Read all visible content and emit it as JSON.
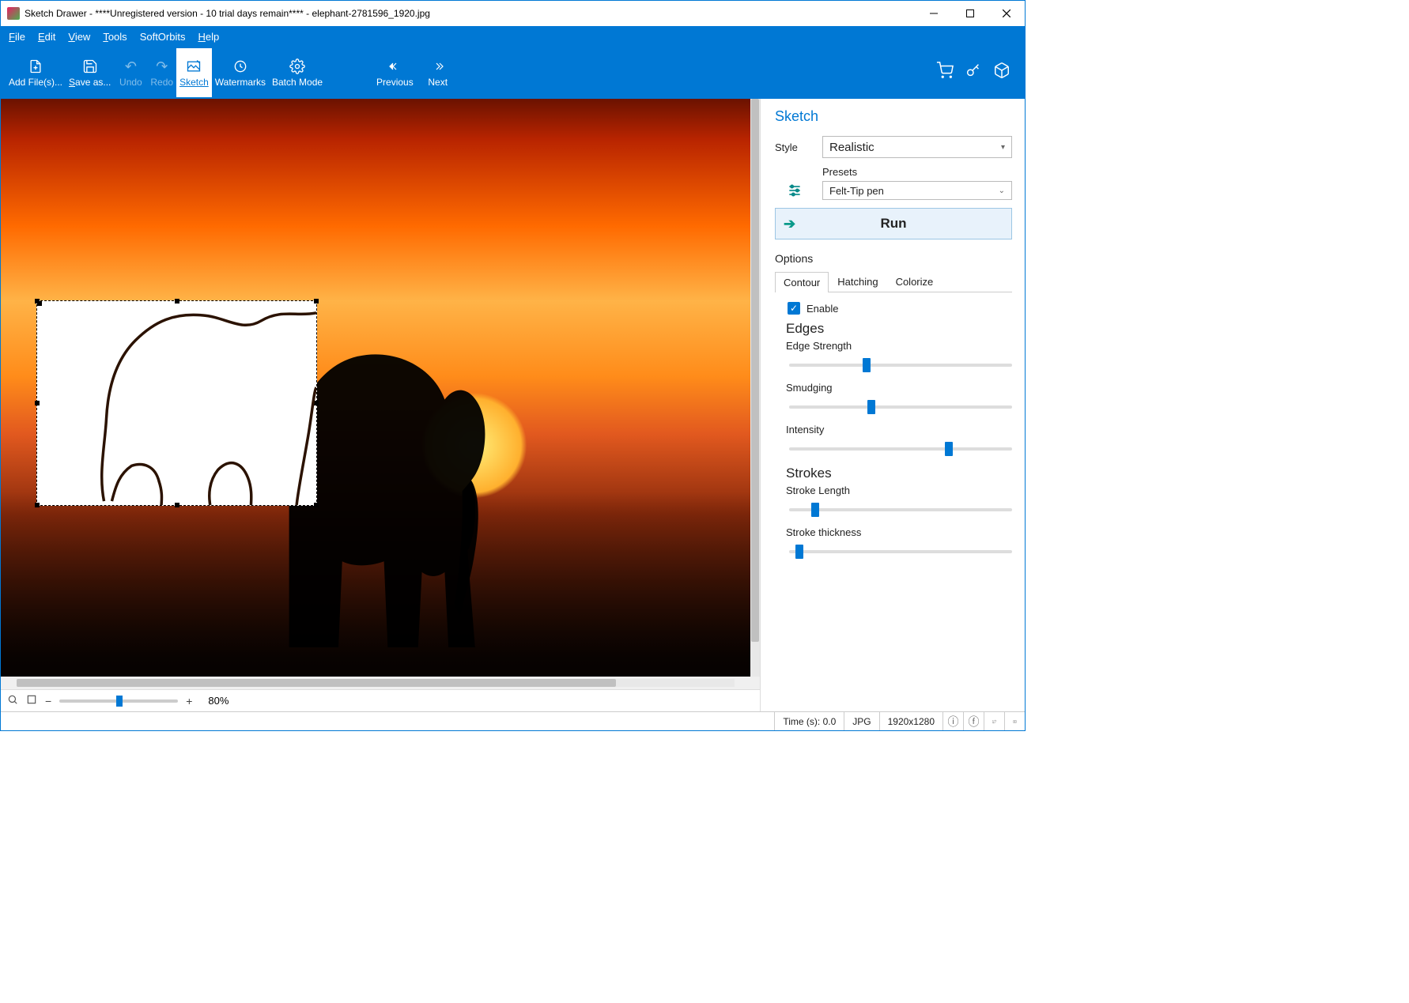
{
  "title": "Sketch Drawer - ****Unregistered version - 10 trial days remain**** - elephant-2781596_1920.jpg",
  "menu": {
    "file": "File",
    "edit": "Edit",
    "view": "View",
    "tools": "Tools",
    "softorbits": "SoftOrbits",
    "help": "Help"
  },
  "toolbar": {
    "add": "Add File(s)...",
    "save": "Save as...",
    "undo": "Undo",
    "redo": "Redo",
    "sketch": "Sketch",
    "watermarks": "Watermarks",
    "batch": "Batch Mode",
    "previous": "Previous",
    "next": "Next"
  },
  "zoom": {
    "percent": "80%"
  },
  "panel": {
    "heading": "Sketch",
    "style_label": "Style",
    "style_value": "Realistic",
    "presets_label": "Presets",
    "presets_value": "Felt-Tip pen",
    "run": "Run",
    "options": "Options",
    "tabs": {
      "contour": "Contour",
      "hatching": "Hatching",
      "colorize": "Colorize"
    },
    "enable": "Enable",
    "edges_heading": "Edges",
    "edge_strength": "Edge Strength",
    "smudging": "Smudging",
    "intensity": "Intensity",
    "strokes_heading": "Strokes",
    "stroke_length": "Stroke Length",
    "stroke_thickness": "Stroke thickness",
    "sliders": {
      "edge_strength": 33,
      "smudging": 35,
      "intensity": 70,
      "stroke_length": 10,
      "stroke_thickness": 3
    }
  },
  "status": {
    "time": "Time (s): 0.0",
    "format": "JPG",
    "dims": "1920x1280"
  }
}
